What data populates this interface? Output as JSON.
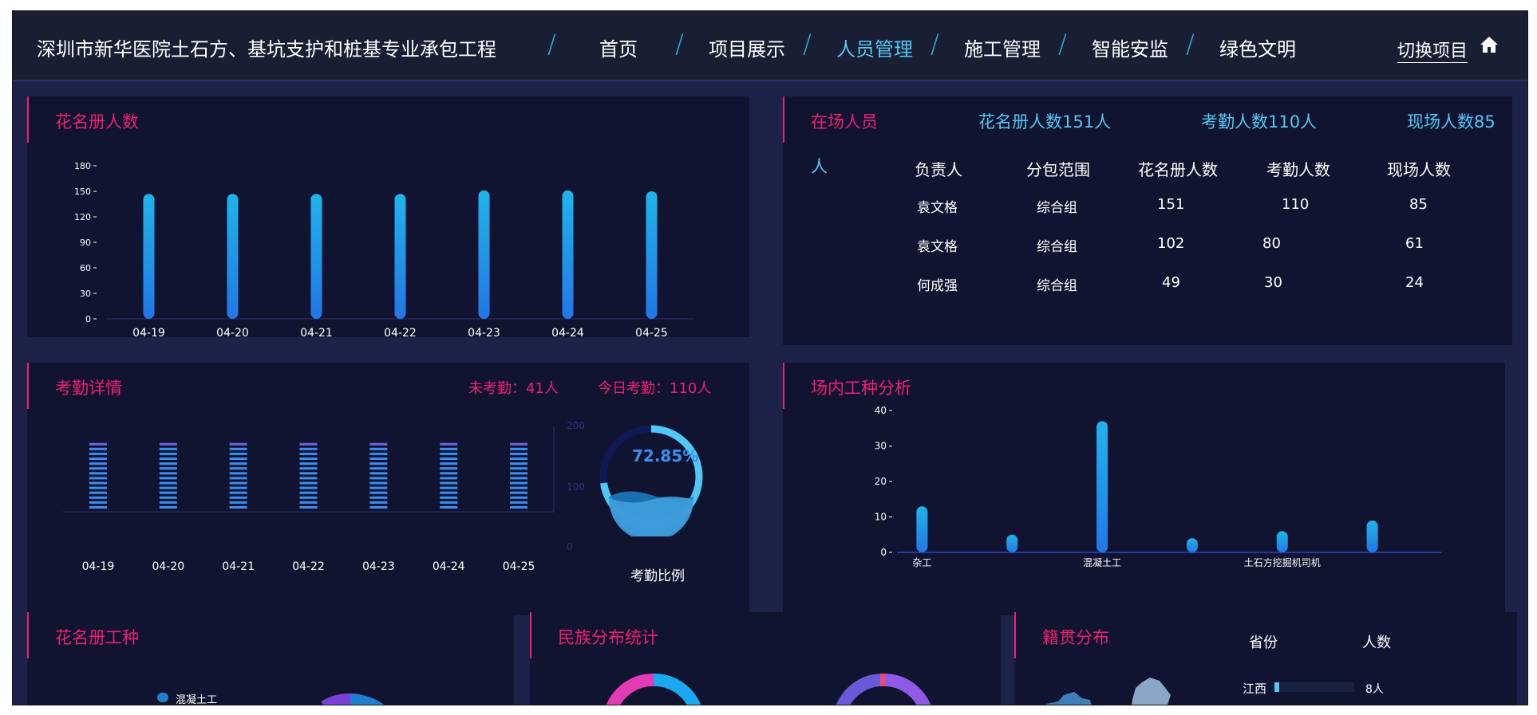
{
  "header": {
    "title": "深圳市新华医院土石方、基坑支护和桩基专业承包工程",
    "nav": [
      "首页",
      "项目展示",
      "人员管理",
      "施工管理",
      "智能安监",
      "绿色文明"
    ],
    "active_nav": "人员管理",
    "switch_label": "切换项目"
  },
  "roster_panel": {
    "title": "花名册人数"
  },
  "onsite_panel": {
    "title": "在场人员",
    "roster_summary": "花名册人数151人",
    "attendance_summary": "考勤人数110人",
    "onsite_summary": "现场人数85",
    "onsite_summary_unit": "人",
    "columns": [
      "负责人",
      "分包范围",
      "花名册人数",
      "考勤人数",
      "现场人数"
    ],
    "rows": [
      [
        "袁文格",
        "综合组",
        "151",
        "110",
        "85"
      ],
      [
        "袁文格",
        "综合组",
        "102",
        "80",
        "61"
      ],
      [
        "何成强",
        "综合组",
        "49",
        "30",
        "24"
      ]
    ]
  },
  "attendance_panel": {
    "title": "考勤详情",
    "absent": "未考勤：41人",
    "today": "今日考勤：110人",
    "gauge_value": "72.85%",
    "gauge_fraction": 0.7285,
    "gauge_label": "考勤比例"
  },
  "worktype_panel": {
    "title": "场内工种分析"
  },
  "bottom": {
    "roster_worktype_title": "花名册工种",
    "roster_worktype_legend": "混凝土工",
    "ethnic_title": "民族分布统计",
    "origin_title": "籍贯分布",
    "origin_col_province": "省份",
    "origin_col_count": "人数",
    "origin_row_province": "江西",
    "origin_row_count": "8人"
  },
  "colors": {
    "accent_pink": "#ee1f73",
    "accent_cyan": "#4ec9f5",
    "panel_bg": "#111430",
    "page_bg": "#1d2248"
  },
  "chart_data": [
    {
      "type": "bar",
      "categories": [
        "04-19",
        "04-20",
        "04-21",
        "04-22",
        "04-23",
        "04-24",
        "04-25"
      ],
      "values": [
        147,
        147,
        147,
        147,
        151,
        151,
        150
      ],
      "ylim": [
        0,
        180
      ],
      "yticks": [
        "0",
        "30",
        "60",
        "90",
        "120",
        "150",
        "180"
      ]
    },
    {
      "type": "bar",
      "categories": [
        "04-19",
        "04-20",
        "04-21",
        "04-22",
        "04-23",
        "04-24",
        "04-25"
      ],
      "values": [
        98,
        98,
        98,
        98,
        102,
        102,
        98
      ],
      "ylim": [
        0,
        200
      ],
      "yticks": [
        "0",
        "100",
        "200"
      ]
    },
    {
      "type": "bar",
      "categories": [
        "杂工",
        "",
        "混凝土工",
        "",
        "土石方挖掘机司机",
        ""
      ],
      "values": [
        13,
        5,
        37,
        4,
        6,
        9
      ],
      "ylim": [
        0,
        40
      ],
      "yticks": [
        "0",
        "10",
        "20",
        "30",
        "40"
      ]
    }
  ]
}
